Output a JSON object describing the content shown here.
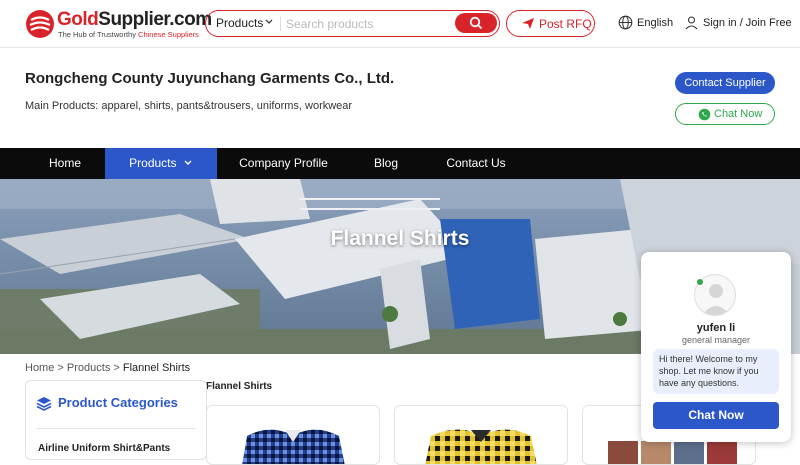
{
  "header": {
    "logo_brand_gold": "Gold",
    "logo_brand_rest": "Supplier.com",
    "logo_tagline_prefix": "The Hub of Trustworthy ",
    "logo_tagline_highlight": "Chinese Suppliers",
    "search_category": "Products",
    "search_placeholder": "Search products",
    "search_icon": "search-icon",
    "rfq_label": "Post RFQ",
    "language_label": "English",
    "signin_label": "Sign in / Join Free"
  },
  "company": {
    "name": "Rongcheng County Juyunchang Garments Co., Ltd.",
    "main_products": "Main Products: apparel, shirts, pants&trousers, uniforms, workwear",
    "contact_label": "Contact Supplier",
    "chat_label": "Chat Now"
  },
  "nav": {
    "items": [
      {
        "label": "Home"
      },
      {
        "label": "Products"
      },
      {
        "label": "Company Profile"
      },
      {
        "label": "Blog"
      },
      {
        "label": "Contact Us"
      }
    ],
    "active": "Products"
  },
  "banner": {
    "title": "Flannel Shirts"
  },
  "breadcrumb": {
    "home": "Home",
    "sep": ">",
    "products": "Products",
    "current": "Flannel Shirts"
  },
  "section_title": "Flannel Shirts",
  "categories": {
    "heading": "Product Categories",
    "first_item": "Airline Uniform Shirt&Pants"
  },
  "chat_widget": {
    "name": "yufen li",
    "role": "general manager",
    "message": "Hi there! Welcome to my shop. Let me know if you have any questions.",
    "button": "Chat Now"
  },
  "colors": {
    "brand_red": "#d9232a",
    "brand_blue": "#2b57c8",
    "whatsapp_green": "#2ea84a",
    "nav_bg": "#0b0b0b"
  }
}
